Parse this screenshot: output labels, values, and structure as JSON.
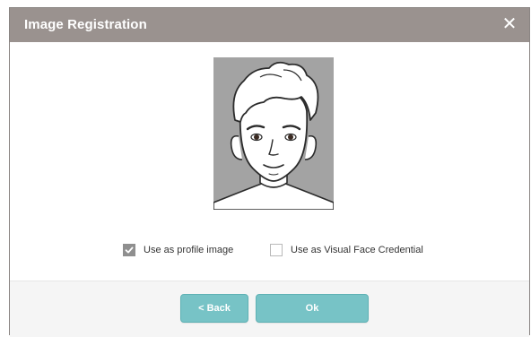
{
  "dialog": {
    "title": "Image Registration",
    "close_symbol": "✕"
  },
  "options": [
    {
      "label": "Use as profile image",
      "checked": true
    },
    {
      "label": "Use as Visual Face Credential",
      "checked": false
    }
  ],
  "buttons": {
    "back_label": "< Back",
    "ok_label": "Ok"
  },
  "colors": {
    "titlebar": "#9a928f",
    "button": "#77c3c6",
    "photo_bg": "#a3a3a3"
  },
  "icons": {
    "close": "close-icon",
    "check": "checkmark-icon",
    "photo": "face-illustration"
  }
}
